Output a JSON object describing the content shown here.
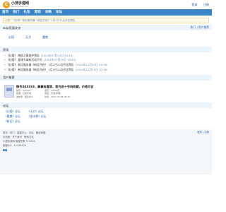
{
  "header": {
    "logo_mark": "C",
    "logo_title": "小茂手游网",
    "logo_sub": "www.xiaomao.com",
    "login": "登录",
    "register": "注册"
  },
  "nav": [
    "首页",
    "热门",
    "礼包",
    "游戏",
    "攻略",
    "论坛"
  ],
  "notice": {
    "tag": "公告",
    "text": "《幻塔》新区服务器《新区开启》 1月1日10点开区预告"
  },
  "section_hot": {
    "title": "wap页面文字",
    "links": "热门 | 用户推荐"
  },
  "tabs": [
    "幻塔",
    "天刀",
    "魔兽"
  ],
  "section_news": {
    "title": "资讯"
  },
  "news": [
    {
      "title": "《幻塔》 晓园之章维护预告",
      "date": "(2024年07月25日 10:43)"
    },
    {
      "title": "《幻塔》 星球天域新活动介绍",
      "date": "(2024年07月25日 10:43)"
    },
    {
      "title": "《幻塔》 新区服务器《新区开启》 1月1日10点开区预告",
      "date": "(2024年11月03日 09:36)"
    },
    {
      "title": "《幻塔》 新区服务器《新区开启》 1月1日10点开区预告",
      "date": "(2024年12月31日 10:16)"
    }
  ],
  "section_user": {
    "title": "用户推荐"
  },
  "card": {
    "title": "微号343333，事事有着落，首充送十号码收藏，价格可议",
    "meta": [
      "账号：343333",
      "金币：10000币",
      "区服：幻塔天域",
      "类型：手游(苹果)",
      "发布者：陌生的人",
      "时间：2021-07-08 18:30"
    ]
  },
  "section_forum": {
    "title": "论坛"
  },
  "forums": [
    [
      "《幻塔》论坛",
      "《天刀》论坛"
    ],
    [
      "《魔兽》论坛",
      "《逆水寒》论坛"
    ],
    [
      "《新区》论坛"
    ]
  ],
  "footer": {
    "links": "首页 · 热门 · 客服中心 · 论坛 · 网站地图",
    "right": "登录 | 注册",
    "line2": "手机版 · 关于我们 · 联系方式",
    "line3": "小茂手游网 版权所有 © 2024",
    "line4": "客服QQ：12345678",
    "badge": "ICP"
  }
}
